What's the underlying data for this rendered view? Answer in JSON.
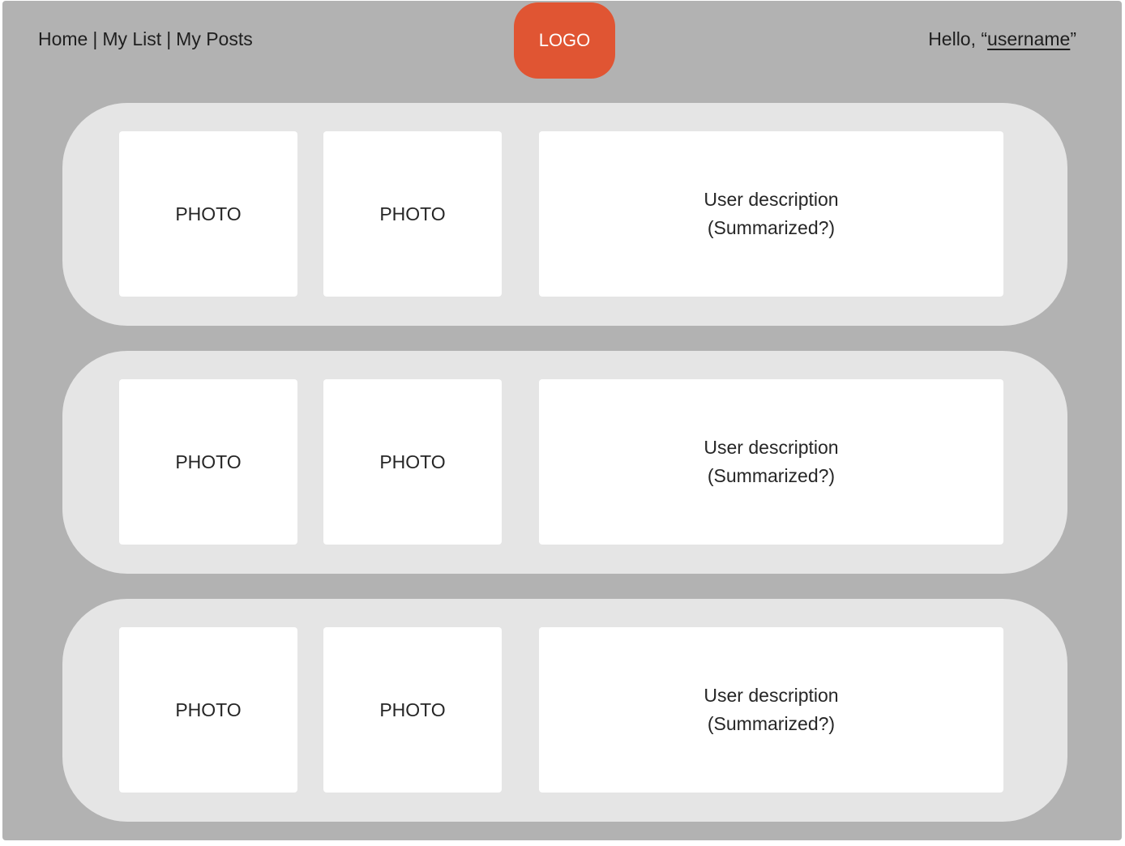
{
  "nav": {
    "items": [
      "Home",
      "My List",
      "My Posts"
    ],
    "separator": "|"
  },
  "logo": {
    "label": "LOGO"
  },
  "greeting": {
    "prefix": "Hello, “",
    "username": "username",
    "suffix": "”"
  },
  "posts": [
    {
      "photo1": "PHOTO",
      "photo2": "PHOTO",
      "desc_line1": "User description",
      "desc_line2": "(Summarized?)"
    },
    {
      "photo1": "PHOTO",
      "photo2": "PHOTO",
      "desc_line1": "User description",
      "desc_line2": "(Summarized?)"
    },
    {
      "photo1": "PHOTO",
      "photo2": "PHOTO",
      "desc_line1": "User description",
      "desc_line2": "(Summarized?)"
    }
  ],
  "colors": {
    "background": "#b2b2b2",
    "card": "#e5e5e5",
    "panel": "#ffffff",
    "logo": "#e05533",
    "text": "#1f1f1f"
  }
}
